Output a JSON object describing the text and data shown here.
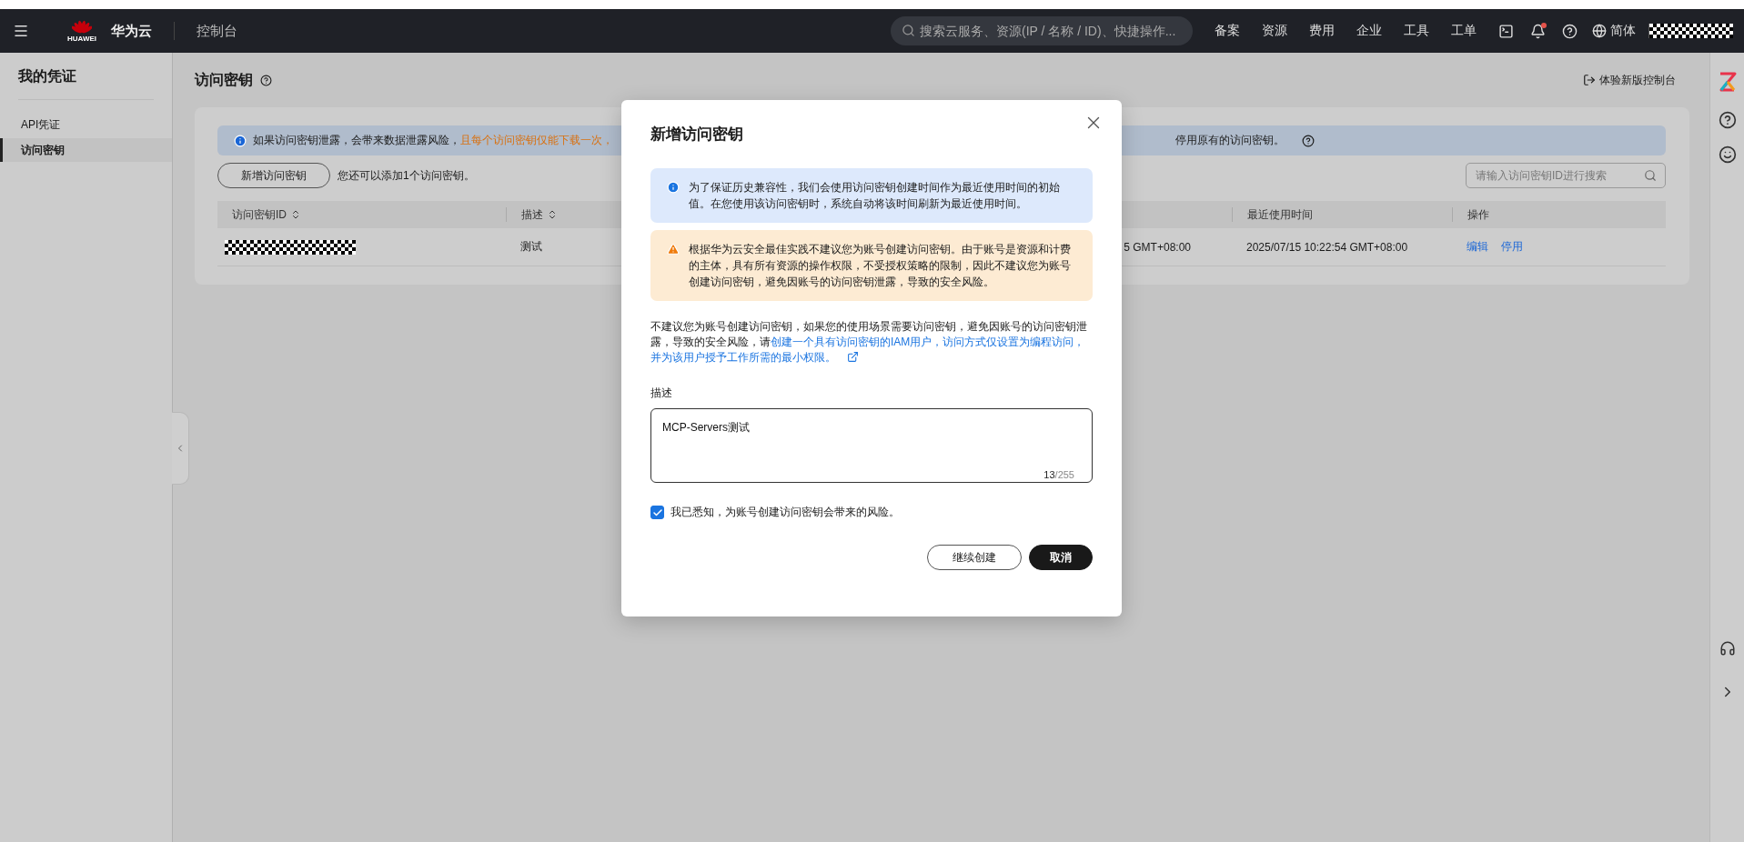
{
  "top_bar": {
    "logo_caption": "HUAWEI",
    "brand": "华为云",
    "console": "控制台",
    "search": {
      "placeholder": "搜索云服务、资源(IP / 名称 / ID)、快捷操作..."
    },
    "nav": [
      "备案",
      "资源",
      "费用",
      "企业",
      "工具",
      "工单"
    ],
    "notifications": {
      "unread": true
    },
    "language": "简体"
  },
  "sidebar": {
    "title": "我的凭证",
    "items": [
      {
        "label": "API凭证",
        "selected": false
      },
      {
        "label": "访问密钥",
        "selected": true
      }
    ]
  },
  "page": {
    "title": "访问密钥",
    "new_console_link": "体验新版控制台",
    "alert": {
      "text": "如果访问密钥泄露，会带来数据泄露风险，",
      "highlight": "且每个访问密钥仅能下载一次，",
      "tail": "停用原有的访问密钥。"
    },
    "add_button": "新增访问密钥",
    "quota": "您还可以添加1个访问密钥。",
    "search": {
      "placeholder": "请输入访问密钥ID进行搜索"
    },
    "table": {
      "columns": [
        {
          "label": "访问密钥ID",
          "sortable": true
        },
        {
          "label": "描述",
          "sortable": true
        },
        {
          "label": "最近使用时间",
          "sortable": false
        },
        {
          "label": "操作",
          "sortable": false
        }
      ],
      "rows": [
        {
          "description": "测试",
          "created_partial": "5 GMT+08:00",
          "last_used": "2025/07/15 10:22:54 GMT+08:00",
          "actions": [
            "编辑",
            "停用"
          ]
        }
      ]
    }
  },
  "dialog": {
    "title": "新增访问密钥",
    "info": "为了保证历史兼容性，我们会使用访问密钥创建时间作为最近使用时间的初始值。在您使用该访问密钥时，系统自动将该时间刷新为最近使用时间。",
    "warning": "根据华为云安全最佳实践不建议您为账号创建访问密钥。由于账号是资源和计费的主体，具有所有资源的操作权限，不受授权策略的限制，因此不建议您为账号创建访问密钥，避免因账号的访问密钥泄露，导致的安全风险。",
    "notice": {
      "text": "不建议您为账号创建访问密钥，如果您的使用场景需要访问密钥，避免因账号的访问密钥泄露，导致的安全风险，请",
      "link_lines": [
        "创建一个具有访问密钥的IAM用户，访问方式仅设置为编程访问，",
        "并为该用户授予工作所需的最小权限。"
      ]
    },
    "field": {
      "label": "描述",
      "value": "MCP-Servers测试",
      "count": "13",
      "limit": "/255"
    },
    "acknowledge": {
      "label": "我已悉知，为账号创建访问密钥会带来的风险。",
      "checked": true
    },
    "buttons": [
      {
        "label": "继续创建",
        "kind": "secondary"
      },
      {
        "label": "取消",
        "kind": "primary"
      }
    ]
  }
}
